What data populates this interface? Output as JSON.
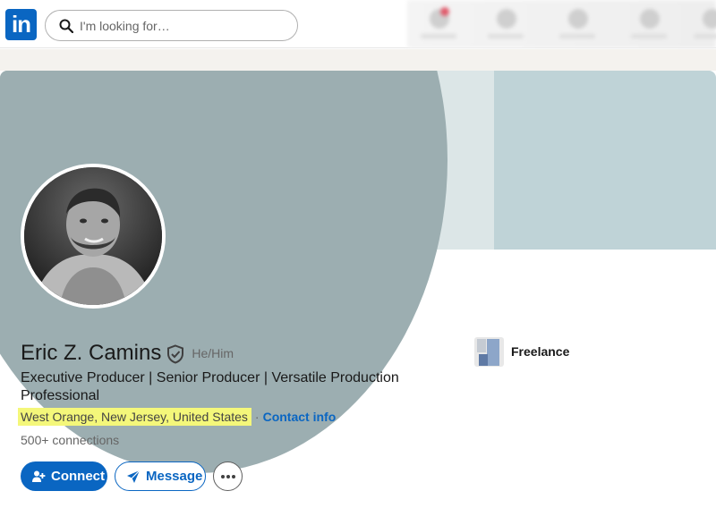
{
  "header": {
    "logo_text": "in",
    "search": {
      "placeholder": "I'm looking for…"
    }
  },
  "profile": {
    "name": "Eric Z. Camins",
    "pronouns": "He/Him",
    "headline": "Executive Producer | Senior Producer | Versatile Production Professional",
    "location": "West Orange, New Jersey, United States",
    "separator": "·",
    "contact_info_label": "Contact info",
    "connections": "500+ connections",
    "current_company": "Freelance"
  },
  "actions": {
    "connect_label": "Connect",
    "message_label": "Message"
  },
  "colors": {
    "brand": "#0a66c2",
    "highlight": "#f4f77a",
    "banner_primary": "#9caeb1",
    "banner_secondary": "#bfd3d7"
  },
  "icons": {
    "search": "search-icon",
    "verified": "verified-shield-icon",
    "connect": "add-person-icon",
    "message": "send-icon",
    "more": "more-horizontal-icon"
  }
}
